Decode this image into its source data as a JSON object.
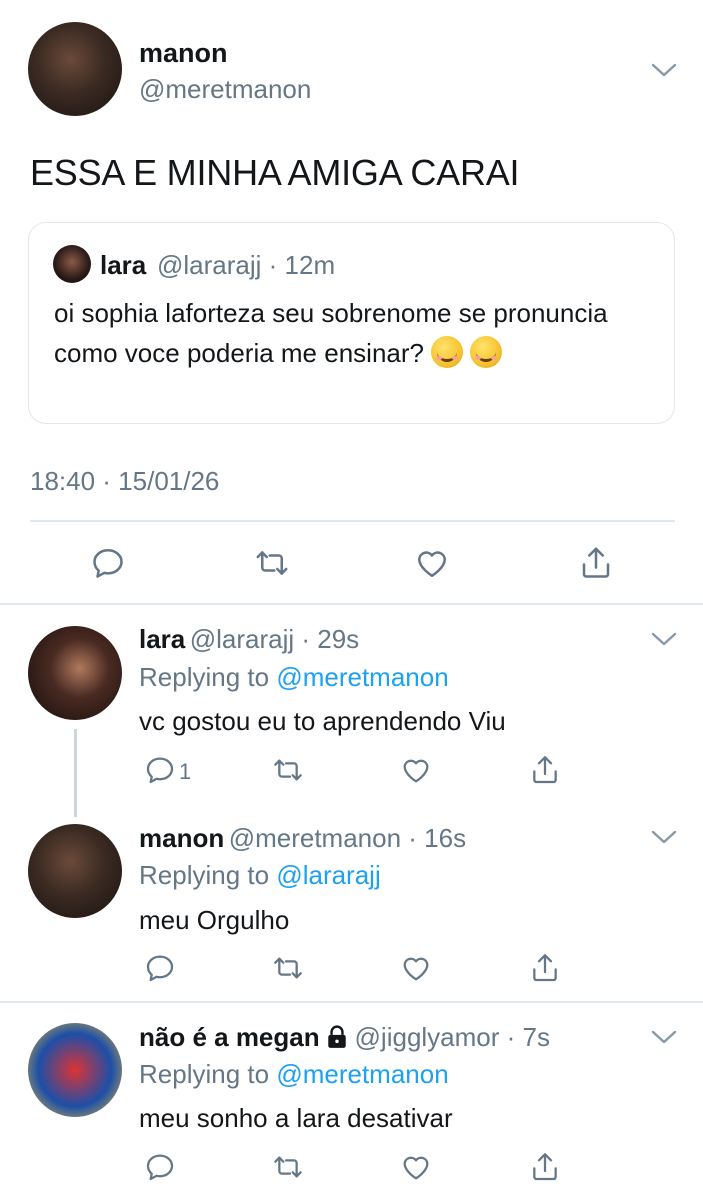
{
  "main_tweet": {
    "name": "manon",
    "handle": "@meretmanon",
    "text": "ESSA E MINHA AMIGA CARAI",
    "timestamp": "18:40 · 15/01/26",
    "quote": {
      "name": "lara",
      "handle_time": "@lararajj · 12m",
      "text": "oi sophia laforteza seu sobrenome se pronuncia como voce poderia me ensinar?"
    }
  },
  "replies": [
    {
      "name": "lara",
      "handle_time": "@lararajj · 29s",
      "replying_prefix": "Replying to ",
      "replying_to": "@meretmanon",
      "text": "vc gostou eu to aprendendo Viu",
      "reply_count": "1"
    },
    {
      "name": "manon",
      "handle_time": "@meretmanon · 16s",
      "replying_prefix": "Replying to ",
      "replying_to": "@lararajj",
      "text": "meu Orgulho"
    },
    {
      "name": "não é a megan",
      "handle_time": "@jigglyamor · 7s",
      "replying_prefix": "Replying to ",
      "replying_to": "@meretmanon",
      "text": "meu sonho a lara desativar"
    }
  ],
  "colors": {
    "text": "#14171a",
    "secondary": "#657786",
    "link": "#1da1f2",
    "divider": "#e1e8ed",
    "thread_line": "#ccd6dd"
  },
  "icons": [
    "reply-icon",
    "retweet-icon",
    "like-icon",
    "share-icon",
    "chevron-down-icon",
    "lock-icon",
    "smiling-face-emoji"
  ]
}
